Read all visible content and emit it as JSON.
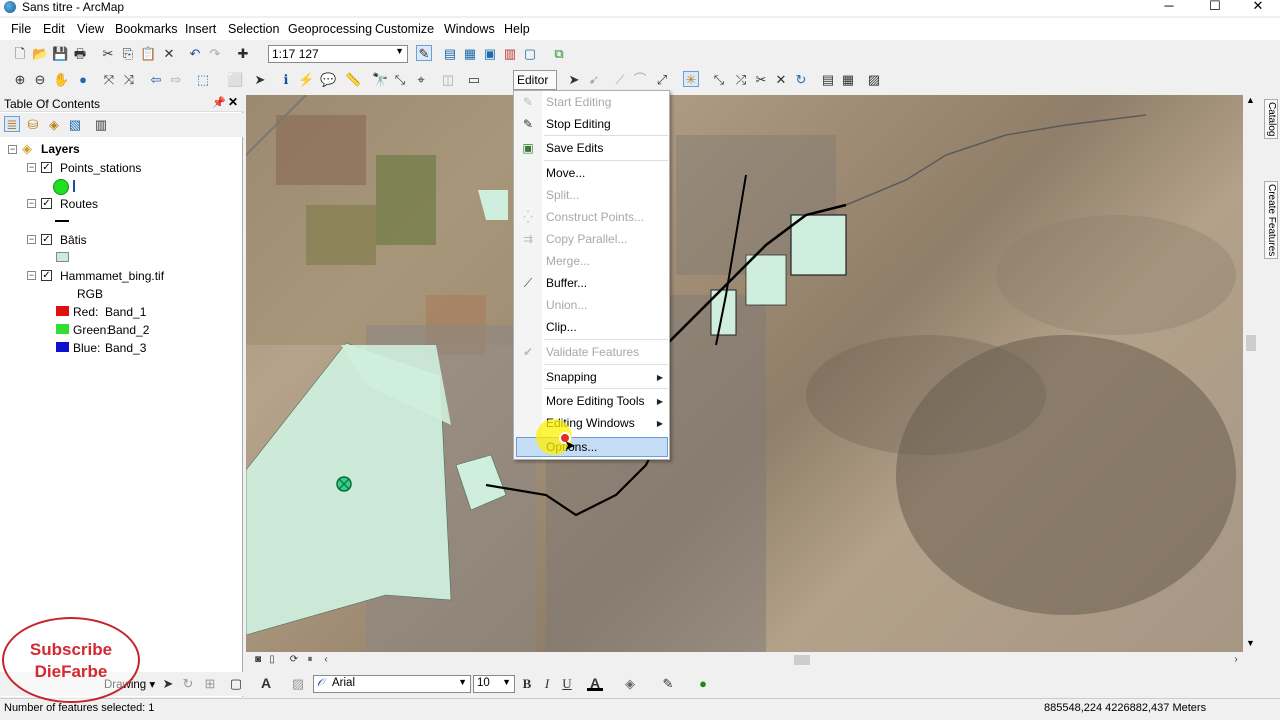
{
  "window": {
    "title": "Sans titre - ArcMap",
    "controls": {
      "minimize": "─",
      "maximize": "☐",
      "close": "✕"
    }
  },
  "menubar": {
    "items": [
      "File",
      "Edit",
      "View",
      "Bookmarks",
      "Insert",
      "Selection",
      "Geoprocessing",
      "Customize",
      "Windows",
      "Help"
    ]
  },
  "toolbar": {
    "scale": "1:17 127",
    "editor_label": "Editor ▾"
  },
  "toc": {
    "title": "Table Of Contents",
    "root": "Layers",
    "layers": [
      {
        "name": "Points_stations",
        "checked": true
      },
      {
        "name": "Routes",
        "checked": true
      },
      {
        "name": "Bâtis",
        "checked": true
      },
      {
        "name": "Hammamet_bing.tif",
        "checked": true,
        "renderer": "RGB",
        "bands": [
          {
            "label": "Red:",
            "band": "Band_1",
            "color": "#e01010"
          },
          {
            "label": "Green:",
            "band": "Band_2",
            "color": "#30e030"
          },
          {
            "label": "Blue:",
            "band": "Band_3",
            "color": "#1010d0"
          }
        ]
      }
    ]
  },
  "editor_menu": {
    "items": [
      {
        "label": "Start Editing",
        "enabled": false,
        "icon": "pencil-icon"
      },
      {
        "label": "Stop Editing",
        "enabled": true,
        "icon": "pencil-stop-icon"
      },
      {
        "label": "Save Edits",
        "enabled": true,
        "icon": "save-edits-icon"
      },
      {
        "label": "Move...",
        "enabled": true
      },
      {
        "label": "Split...",
        "enabled": false
      },
      {
        "label": "Construct Points...",
        "enabled": false,
        "icon": "construct-points-icon"
      },
      {
        "label": "Copy Parallel...",
        "enabled": false,
        "icon": "copy-parallel-icon"
      },
      {
        "label": "Merge...",
        "enabled": false
      },
      {
        "label": "Buffer...",
        "enabled": true,
        "icon": "buffer-icon"
      },
      {
        "label": "Union...",
        "enabled": false
      },
      {
        "label": "Clip...",
        "enabled": true
      },
      {
        "label": "Validate Features",
        "enabled": false,
        "icon": "validate-icon"
      },
      {
        "label": "Snapping",
        "enabled": true,
        "submenu": true
      },
      {
        "label": "More Editing Tools",
        "enabled": true,
        "submenu": true
      },
      {
        "label": "Editing Windows",
        "enabled": true,
        "submenu": true
      },
      {
        "label": "Options...",
        "enabled": true,
        "highlighted": true
      }
    ]
  },
  "draw_toolbar": {
    "drawing_label": "Drawing ▾",
    "font": "Arial",
    "font_size": "10",
    "bold": "B",
    "italic": "I",
    "underline": "U"
  },
  "right_dock": {
    "tabs": [
      "Catalog",
      "Create Features"
    ]
  },
  "status": {
    "selection": "Number of features selected: 1",
    "coordinates": "885548,224  4226882,437 Meters"
  },
  "watermark": {
    "line1": "Subscribe",
    "line2": "DieFarbe"
  }
}
